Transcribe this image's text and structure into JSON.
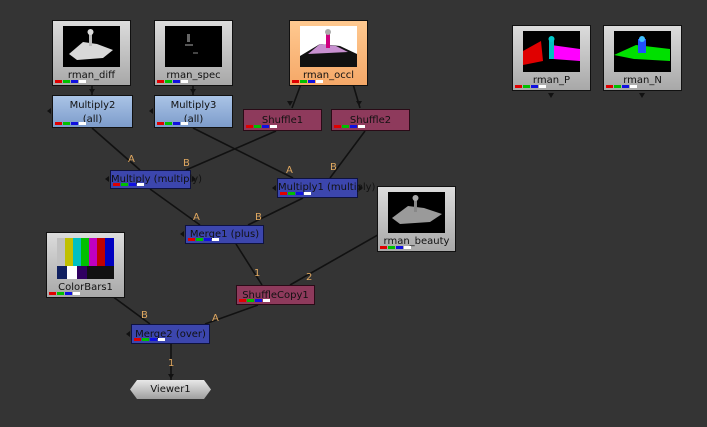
{
  "nodes": {
    "rman_diff": "rman_diff",
    "rman_spec": "rman_spec",
    "rman_occl": "rman_occl",
    "rman_P": "rman_P",
    "rman_N": "rman_N",
    "multiply2": "Multiply2",
    "multiply2_sub": "(all)",
    "multiply3": "Multiply3",
    "multiply3_sub": "(all)",
    "shuffle1": "Shuffle1",
    "shuffle2": "Shuffle2",
    "multiply": "Multiply (multiply)",
    "multiply1": "Multiply1 (multiply)",
    "merge1": "Merge1 (plus)",
    "rman_beauty": "rman_beauty",
    "colorbars1": "ColorBars1",
    "shufflecopy1": "ShuffleCopy1",
    "merge2": "Merge2 (over)",
    "viewer1": "Viewer1"
  },
  "inputs": {
    "a": "A",
    "b": "B",
    "one": "1",
    "two": "2"
  },
  "colors": {
    "background": "#343434",
    "read_node": "#c8c8c8",
    "selected_read": "#ffb070",
    "op_node": "#8eaede",
    "shuffle_node": "#8e3a5c",
    "merge_node": "#3c46ad",
    "wire": "#000000"
  }
}
